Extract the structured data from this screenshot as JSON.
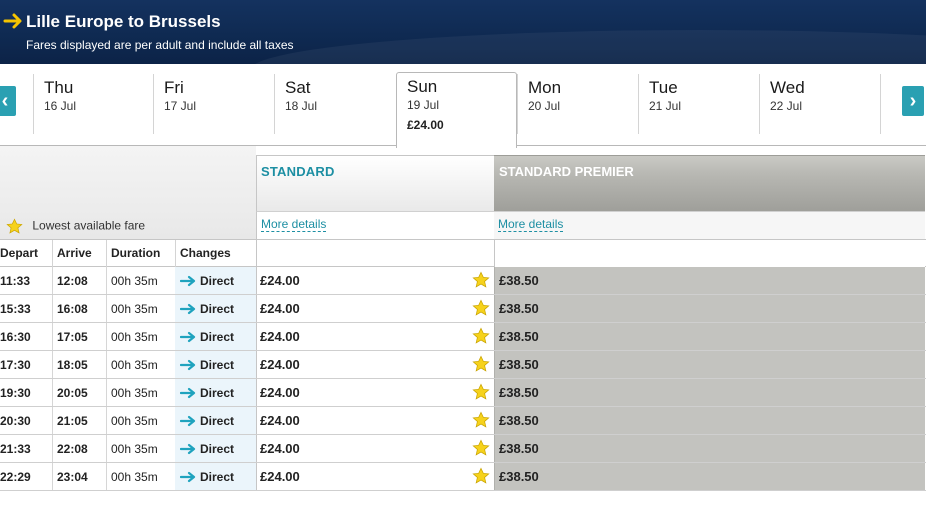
{
  "header": {
    "title": "Lille Europe to Brussels",
    "subtitle": "Fares displayed are per adult and include all taxes",
    "arrow_color": "#f5c400"
  },
  "date_nav": {
    "prev_icon": "chevron-left",
    "next_icon": "chevron-right",
    "accent": "#2aa0b2",
    "days": [
      {
        "name": "Thu",
        "date": "16 Jul",
        "price": ""
      },
      {
        "name": "Fri",
        "date": "17 Jul",
        "price": ""
      },
      {
        "name": "Sat",
        "date": "18 Jul",
        "price": ""
      },
      {
        "name": "Sun",
        "date": "19 Jul",
        "price": "£24.00",
        "selected": true
      },
      {
        "name": "Mon",
        "date": "20 Jul",
        "price": ""
      },
      {
        "name": "Tue",
        "date": "21 Jul",
        "price": ""
      },
      {
        "name": "Wed",
        "date": "22 Jul",
        "price": ""
      }
    ]
  },
  "legend": {
    "icon": "star-icon",
    "label": "Lowest available fare"
  },
  "fare_classes": {
    "standard": {
      "title": "STANDARD",
      "more": "More details"
    },
    "premier": {
      "title": "STANDARD PREMIER",
      "more": "More details"
    }
  },
  "columns": {
    "depart": "Depart",
    "arrive": "Arrive",
    "duration": "Duration",
    "changes": "Changes"
  },
  "journeys": [
    {
      "depart": "11:33",
      "arrive": "12:08",
      "duration": "00h 35m",
      "changes": "Direct",
      "standard": "£24.00",
      "premier": "£38.50",
      "lowest": true
    },
    {
      "depart": "15:33",
      "arrive": "16:08",
      "duration": "00h 35m",
      "changes": "Direct",
      "standard": "£24.00",
      "premier": "£38.50",
      "lowest": true
    },
    {
      "depart": "16:30",
      "arrive": "17:05",
      "duration": "00h 35m",
      "changes": "Direct",
      "standard": "£24.00",
      "premier": "£38.50",
      "lowest": true
    },
    {
      "depart": "17:30",
      "arrive": "18:05",
      "duration": "00h 35m",
      "changes": "Direct",
      "standard": "£24.00",
      "premier": "£38.50",
      "lowest": true
    },
    {
      "depart": "19:30",
      "arrive": "20:05",
      "duration": "00h 35m",
      "changes": "Direct",
      "standard": "£24.00",
      "premier": "£38.50",
      "lowest": true
    },
    {
      "depart": "20:30",
      "arrive": "21:05",
      "duration": "00h 35m",
      "changes": "Direct",
      "standard": "£24.00",
      "premier": "£38.50",
      "lowest": true
    },
    {
      "depart": "21:33",
      "arrive": "22:08",
      "duration": "00h 35m",
      "changes": "Direct",
      "standard": "£24.00",
      "premier": "£38.50",
      "lowest": true
    },
    {
      "depart": "22:29",
      "arrive": "23:04",
      "duration": "00h 35m",
      "changes": "Direct",
      "standard": "£24.00",
      "premier": "£38.50",
      "lowest": true
    }
  ]
}
